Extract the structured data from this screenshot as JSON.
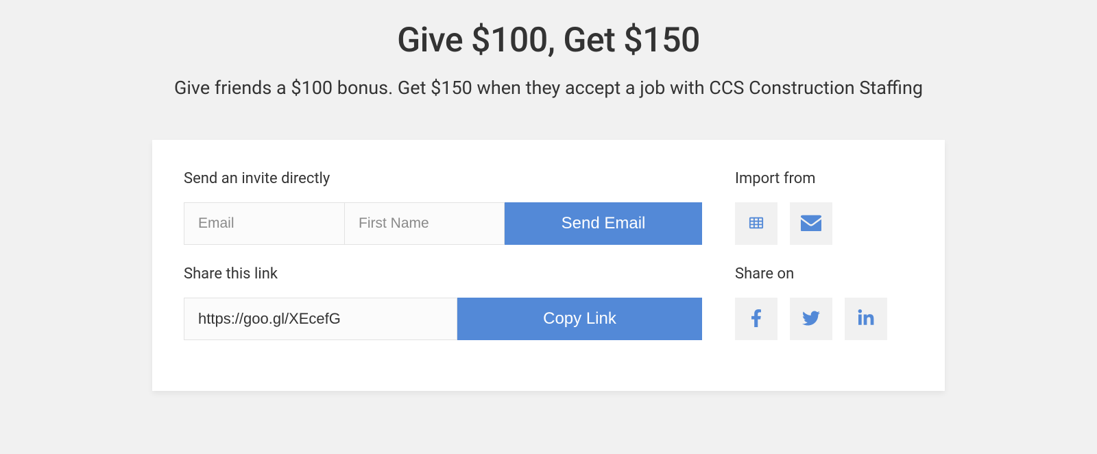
{
  "header": {
    "title": "Give $100, Get $150",
    "subtitle": "Give friends a $100 bonus. Get $150 when they accept a job with CCS Construction Staffing"
  },
  "invite": {
    "section_label": "Send an invite directly",
    "email_placeholder": "Email",
    "firstname_placeholder": "First Name",
    "send_button_label": "Send Email"
  },
  "import": {
    "section_label": "Import from"
  },
  "share_link": {
    "section_label": "Share this link",
    "url": "https://goo.gl/XEcefG",
    "copy_button_label": "Copy Link"
  },
  "share_on": {
    "section_label": "Share on"
  }
}
